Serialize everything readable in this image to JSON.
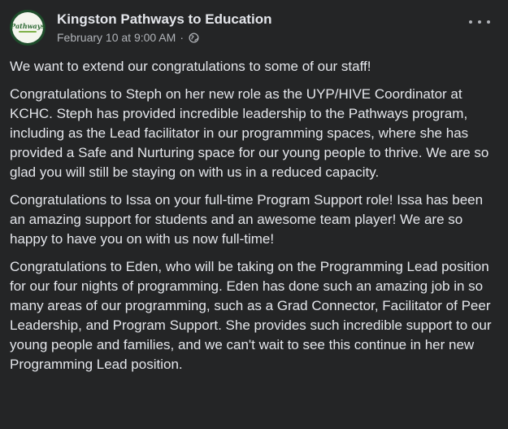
{
  "post": {
    "page_name": "Kingston Pathways to Education",
    "avatar_text": "Pathways",
    "timestamp": "February 10 at 9:00 AM",
    "separator": "·",
    "privacy_icon": "globe-icon",
    "more_icon": "more-options-icon",
    "paragraphs": [
      "We want to extend our congratulations to some of our staff!",
      "Congratulations to Steph on her new role as the UYP/HIVE Coordinator at KCHC. Steph has provided incredible leadership to the Pathways program, including as the Lead facilitator in our programming spaces, where she has provided a Safe and Nurturing space for our young people to thrive. We are so glad you will still be staying on with us in a reduced capacity.",
      "Congratulations to Issa on your full-time Program Support role! Issa has been an amazing support for students and an awesome team player! We are so happy to have you on with us now full-time!",
      "Congratulations to Eden, who will be taking on the Programming Lead position for our four nights of programming. Eden has done such an amazing job in so many areas of our programming, such as a Grad Connector, Facilitator of Peer Leadership, and Program Support. She provides such incredible support to our young people and families, and we can't wait to see this continue in her new Programming Lead position."
    ]
  },
  "colors": {
    "background": "#242526",
    "primary_text": "#e4e6eb",
    "secondary_text": "#b0b3b8",
    "avatar_ring": "#1e4d2b",
    "avatar_logo": "#2f6b36"
  }
}
